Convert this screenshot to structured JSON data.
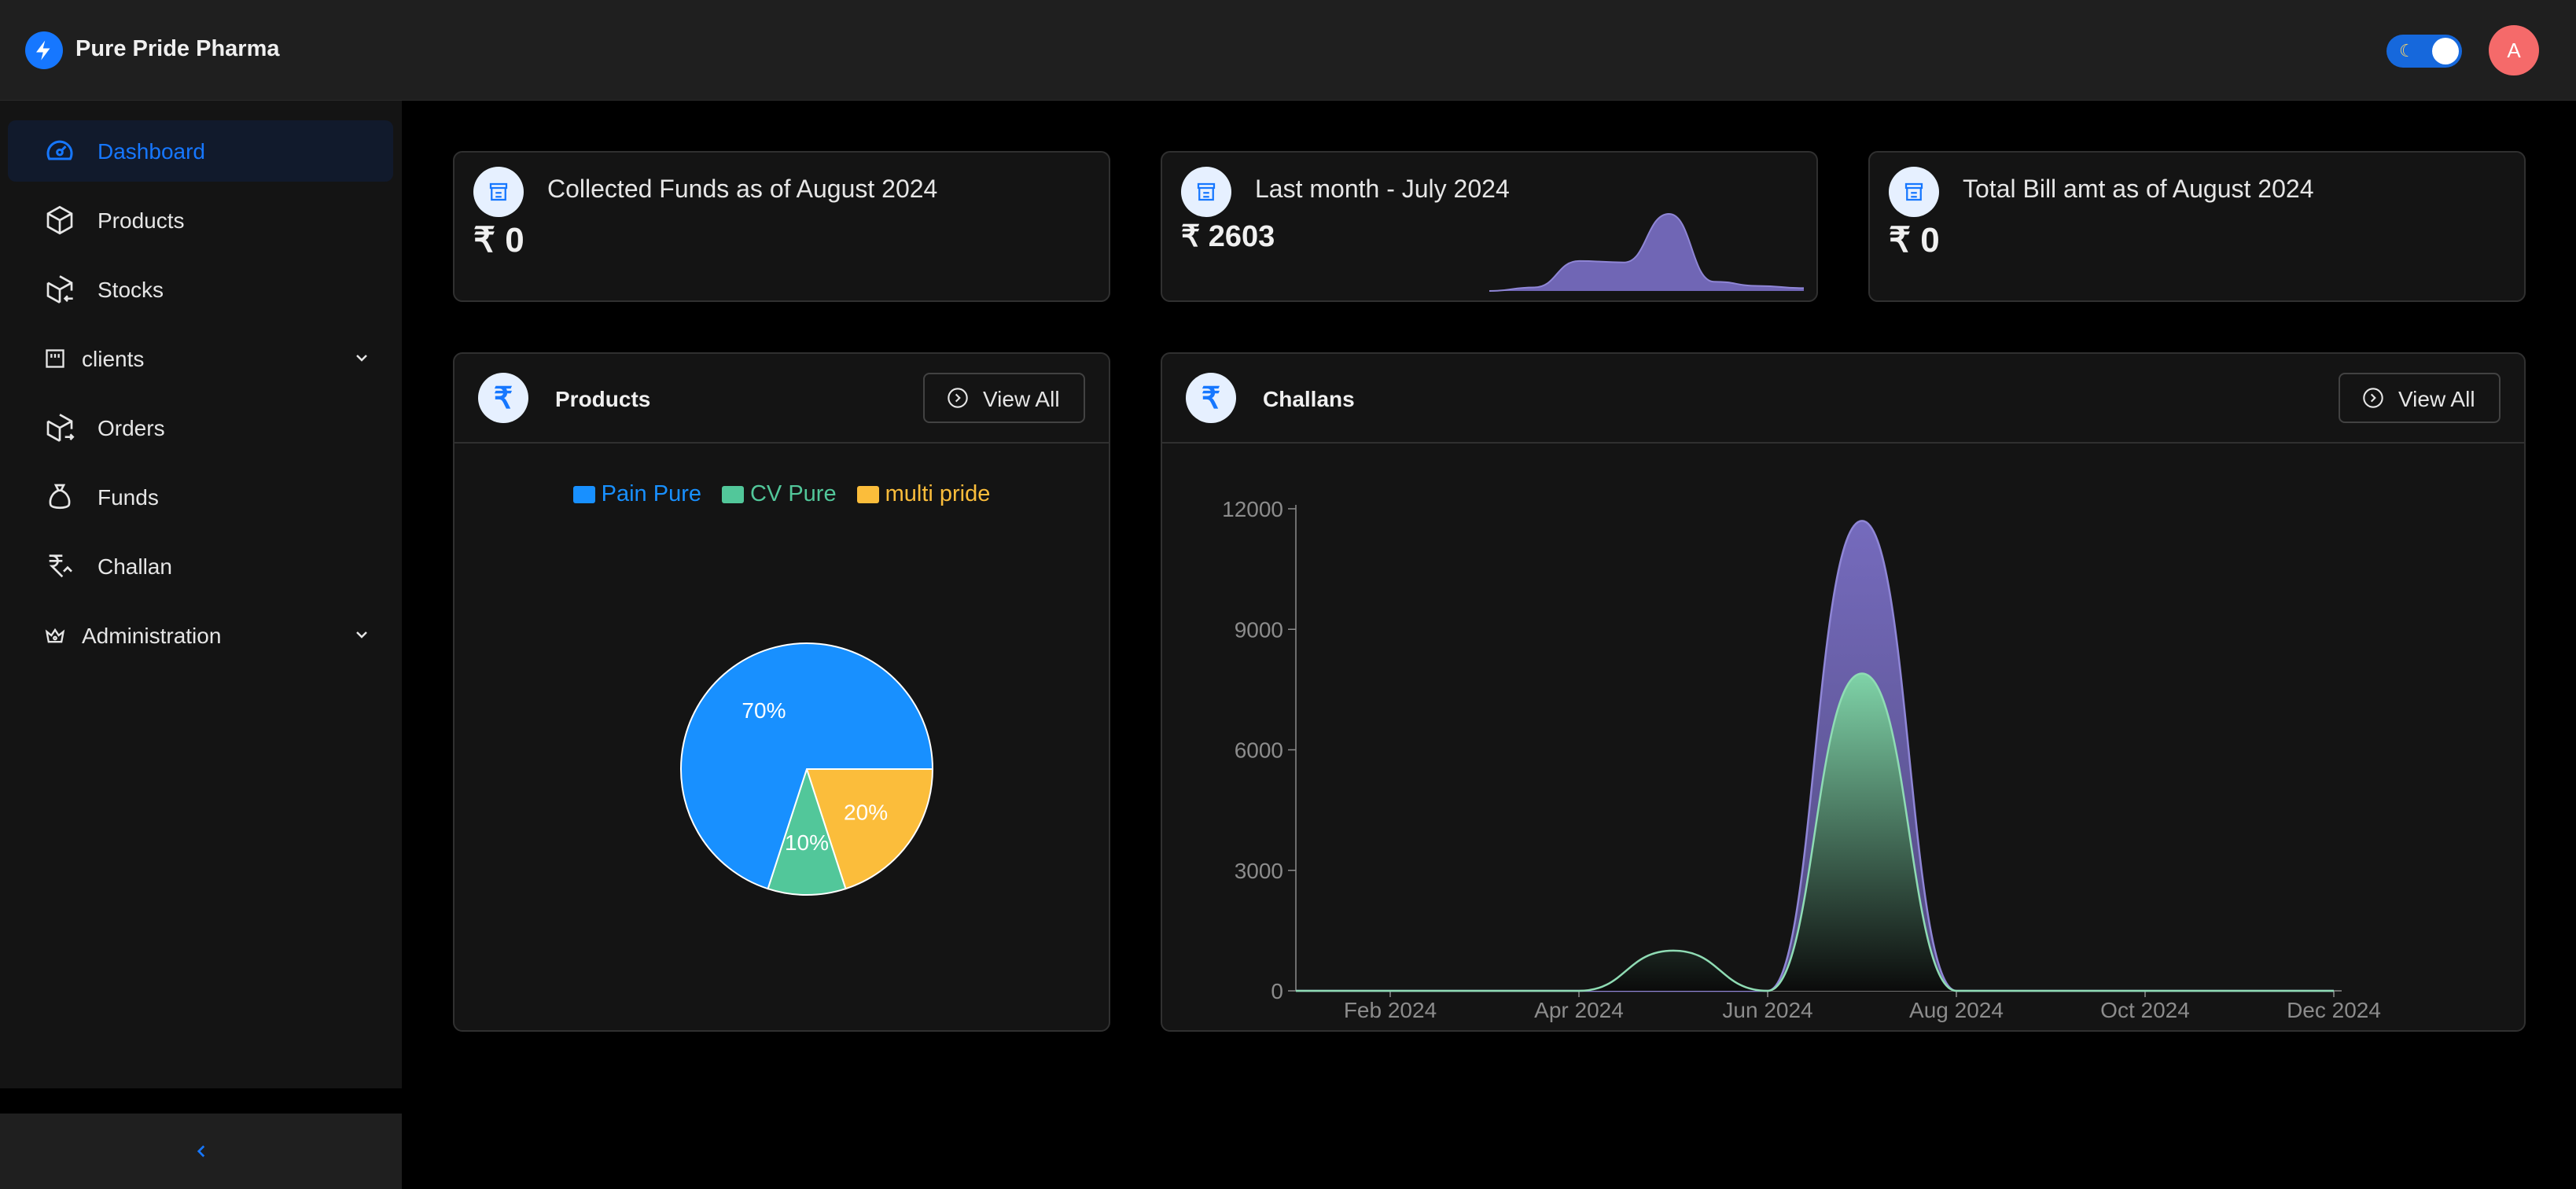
{
  "app": {
    "title": "Pure Pride Pharma"
  },
  "header": {
    "avatar_initial": "A",
    "theme_icon": "moon-icon"
  },
  "sidebar": {
    "items": [
      {
        "label": "Dashboard",
        "icon": "dashboard-icon",
        "active": true
      },
      {
        "label": "Products",
        "icon": "box-icon"
      },
      {
        "label": "Stocks",
        "icon": "box-arrow-in-icon"
      },
      {
        "label": "clients",
        "icon": "building-icon",
        "expandable": true
      },
      {
        "label": "Orders",
        "icon": "box-arrow-out-icon"
      },
      {
        "label": "Funds",
        "icon": "money-bag-icon"
      },
      {
        "label": "Challan",
        "icon": "rupee-icon"
      },
      {
        "label": "Administration",
        "icon": "crown-icon",
        "expandable": true
      }
    ],
    "collapse_icon": "chevron-left-icon"
  },
  "stats": [
    {
      "title": "Collected Funds as of August 2024",
      "value": "₹ 0"
    },
    {
      "title": "Last month - July 2024",
      "value": "₹ 2603"
    },
    {
      "title": "Total Bill amt as of August 2024",
      "value": "₹ 0"
    }
  ],
  "products_panel": {
    "title": "Products",
    "view_all": "View All"
  },
  "challans_panel": {
    "title": "Challans",
    "view_all": "View All"
  },
  "colors": {
    "accent": "#1677ff",
    "pain_pure": "#1890ff",
    "cv_pure": "#52c79a",
    "multi_pride": "#fbbd3b",
    "purple": "#7a6fc6"
  },
  "chart_data": [
    {
      "type": "area",
      "name": "sparkline",
      "x": [
        "Jan 2024",
        "Feb 2024",
        "Mar 2024",
        "Apr 2024",
        "May 2024",
        "Jun 2024",
        "Jul 2024",
        "Aug 2024"
      ],
      "values": [
        0,
        500,
        4200,
        4000,
        10800,
        1300,
        700,
        400
      ]
    },
    {
      "type": "pie",
      "legend": [
        "Pain Pure",
        "CV Pure",
        "multi pride"
      ],
      "values": [
        70,
        10,
        20
      ],
      "labels": [
        "70%",
        "10%",
        "20%"
      ]
    },
    {
      "type": "area",
      "x_ticks": [
        "Feb 2024",
        "Apr 2024",
        "Jun 2024",
        "Aug 2024",
        "Oct 2024",
        "Dec 2024"
      ],
      "y_ticks": [
        "0",
        "3000",
        "6000",
        "9000",
        "12000"
      ],
      "ylim": [
        0,
        12000
      ],
      "series": [
        {
          "x": [
            "Jan 2024",
            "Feb 2024",
            "Mar 2024",
            "Apr 2024",
            "May 2024",
            "Jun 2024",
            "Jul 2024",
            "Aug 2024",
            "Sep 2024",
            "Oct 2024",
            "Nov 2024",
            "Dec 2024"
          ],
          "values": [
            0,
            0,
            0,
            0,
            0,
            0,
            11700,
            0,
            0,
            0,
            0,
            0
          ]
        },
        {
          "x": [
            "Jan 2024",
            "Feb 2024",
            "Mar 2024",
            "Apr 2024",
            "May 2024",
            "Jun 2024",
            "Jul 2024",
            "Aug 2024",
            "Sep 2024",
            "Oct 2024",
            "Nov 2024",
            "Dec 2024"
          ],
          "values": [
            0,
            0,
            0,
            0,
            1000,
            0,
            7900,
            0,
            0,
            0,
            0,
            0
          ]
        }
      ]
    }
  ]
}
